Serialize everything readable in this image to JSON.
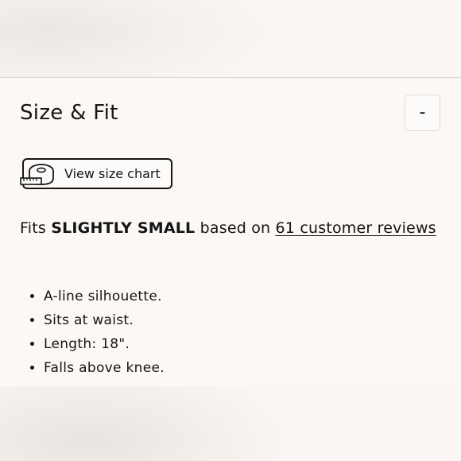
{
  "size_fit": {
    "title": "Size & Fit",
    "toggle_label": "-",
    "size_chart_label": "View size chart",
    "fit_prefix": "Fits ",
    "fit_value": "SLIGHTLY SMALL",
    "fit_middle": " based on ",
    "reviews_link_text": "61 customer reviews",
    "features": [
      "A-line silhouette.",
      "Sits at waist.",
      "Length: 18\".",
      "Falls above knee."
    ]
  },
  "icons": {
    "size_chart": "measuring-tape-icon"
  }
}
